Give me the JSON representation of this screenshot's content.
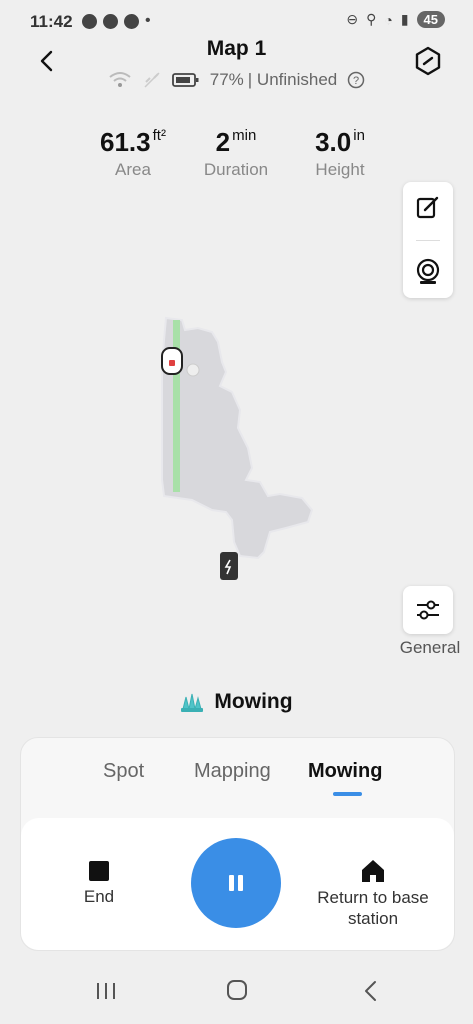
{
  "status_bar": {
    "time": "11:42",
    "battery": "45"
  },
  "header": {
    "title": "Map 1",
    "battery_percent": "77%",
    "state": "| Unfinished"
  },
  "stats": [
    {
      "value": "61.3",
      "unit": "ft²",
      "label": "Area"
    },
    {
      "value": "2",
      "unit": "min",
      "label": "Duration"
    },
    {
      "value": "3.0",
      "unit": "in",
      "label": "Height"
    }
  ],
  "side_tools": {
    "general_label": "General"
  },
  "mode": {
    "current": "Mowing"
  },
  "tabs": [
    {
      "label": "Spot"
    },
    {
      "label": "Mapping"
    },
    {
      "label": "Mowing"
    }
  ],
  "actions": {
    "end_label": "End",
    "return_label_line1": "Return to base",
    "return_label_line2": "station"
  },
  "colors": {
    "accent": "#3a8ee6",
    "map_fill": "#d8d8dc",
    "mowed_path": "#a8e0a8"
  }
}
